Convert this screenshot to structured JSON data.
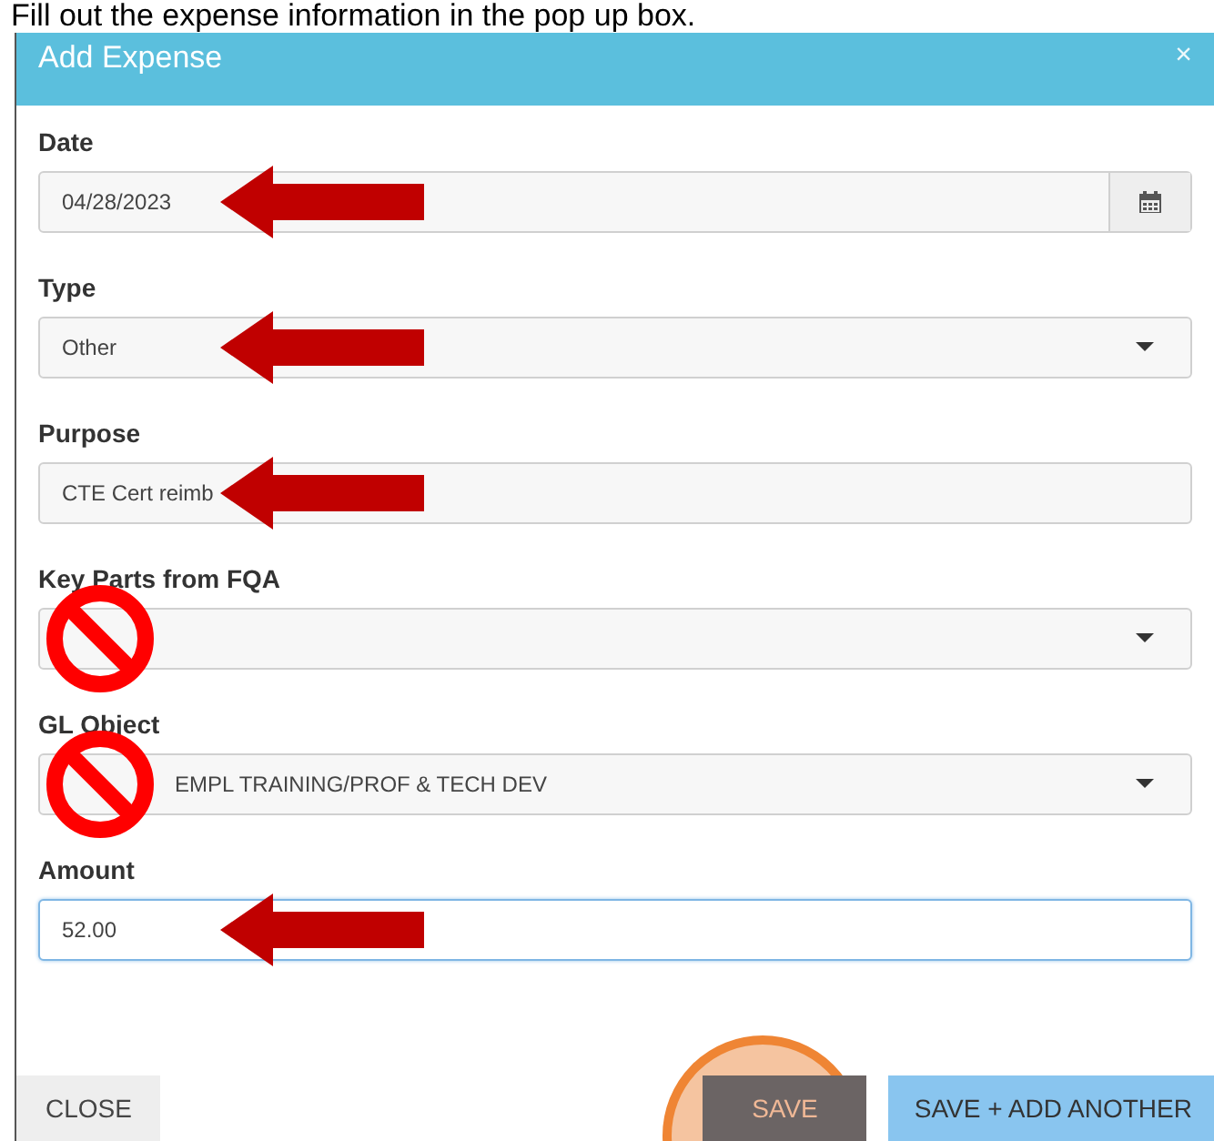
{
  "caption": "Fill out the expense information in the pop up box.",
  "dialog": {
    "title": "Add Expense",
    "close": "×"
  },
  "fields": [
    {
      "label": "Date",
      "kind": "date",
      "value": "04/28/2023",
      "focused": false,
      "annotation": {
        "kind": "arrow"
      }
    },
    {
      "label": "Type",
      "kind": "select",
      "value": "Other",
      "focused": false,
      "annotation": {
        "kind": "arrow"
      }
    },
    {
      "label": "Purpose",
      "kind": "text",
      "value": "CTE Cert reimb",
      "focused": false,
      "annotation": {
        "kind": "arrow"
      }
    },
    {
      "label": "Key Parts from FQA",
      "kind": "select",
      "focused": false,
      "annotation": {
        "kind": "prohibited"
      }
    },
    {
      "label": "GL Object",
      "kind": "select",
      "value": "EMPL TRAINING/PROF & TECH DEV",
      "focused": false,
      "annotation": {
        "kind": "prohibited"
      }
    },
    {
      "label": "Amount",
      "kind": "text",
      "value": "52.00",
      "focused": true,
      "annotation": {
        "kind": "arrow"
      }
    }
  ],
  "buttons": [
    {
      "label": "CLOSE",
      "kind": "plain",
      "highlighted": false
    },
    {
      "label": "SAVE",
      "kind": "dark",
      "highlighted": true
    },
    {
      "label": "SAVE + ADD ANOTHER",
      "kind": "primary",
      "highlighted": false
    }
  ]
}
